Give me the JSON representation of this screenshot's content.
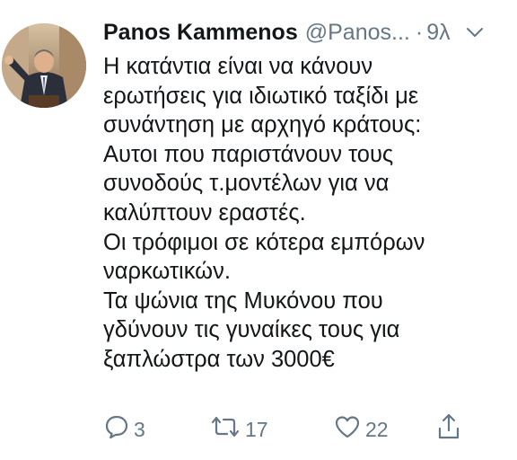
{
  "tweet": {
    "author_name": "Panos Kammenos",
    "handle": "@Panos...",
    "separator": "·",
    "time": "9λ",
    "body_lines": [
      "Η κατάντια είναι να κάνουν",
      "ερωτήσεις για ιδιωτικό ταξίδι με",
      "συνάντηση με αρχηγό κράτους:",
      "Αυτοι που παριστάνουν τους",
      "συνοδούς τ.μοντέλων για να",
      "καλύπτουν εραστές.",
      "Οι τρόφιμοι σε κότερα εμπόρων",
      "ναρκωτικών.",
      "Τα ψώνια της Μυκόνου που",
      "γδύνουν τις γυναίκες τους για",
      "ξαπλώστρα των 3000€"
    ]
  },
  "actions": {
    "reply_count": "3",
    "retweet_count": "17",
    "like_count": "22"
  },
  "icons": {
    "reply": "reply-icon",
    "retweet": "retweet-icon",
    "like": "heart-icon",
    "share": "share-icon",
    "more": "chevron-down-icon"
  },
  "colors": {
    "text": "#14171a",
    "secondary": "#657786"
  }
}
